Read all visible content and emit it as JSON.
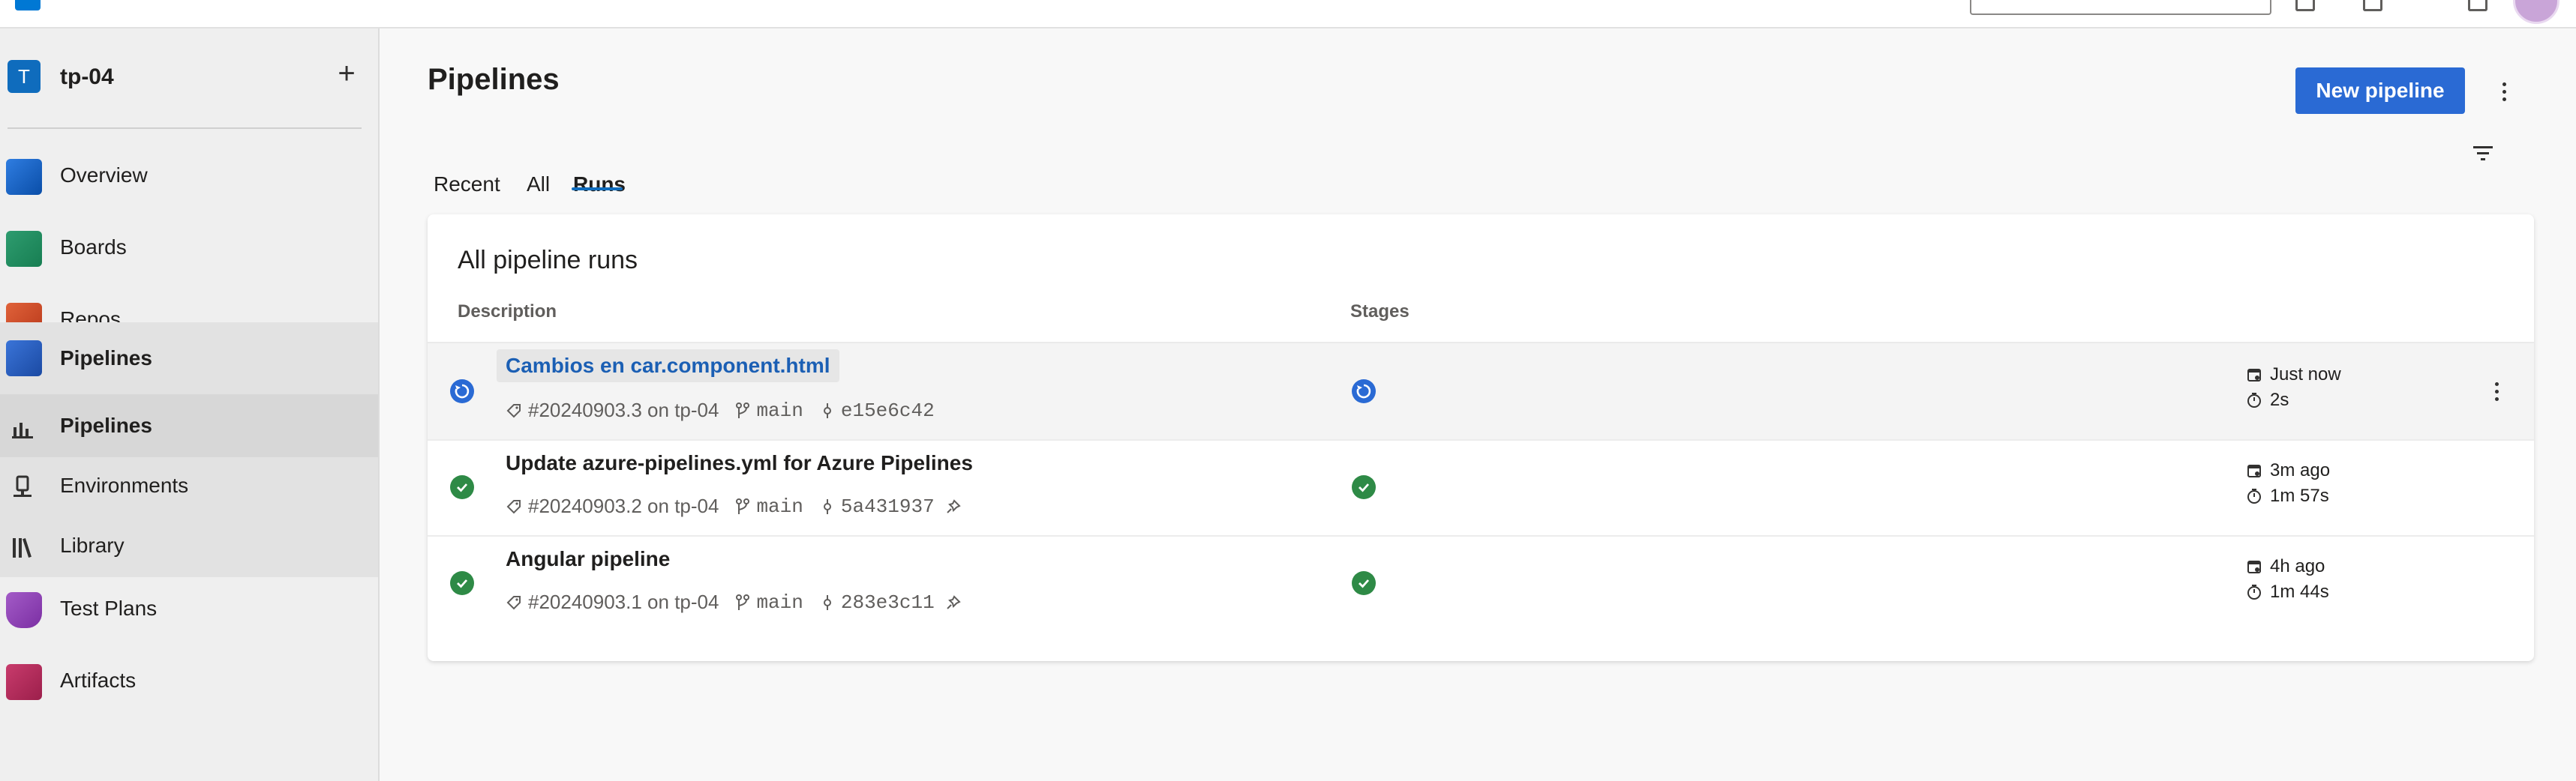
{
  "project": {
    "initial": "T",
    "name": "tp-04"
  },
  "sidebar": {
    "items": [
      {
        "label": "Overview"
      },
      {
        "label": "Boards"
      },
      {
        "label": "Repos"
      },
      {
        "label": "Pipelines"
      },
      {
        "label": "Pipelines"
      },
      {
        "label": "Environments"
      },
      {
        "label": "Library"
      },
      {
        "label": "Test Plans"
      },
      {
        "label": "Artifacts"
      }
    ]
  },
  "main": {
    "title": "Pipelines",
    "new_button": "New pipeline",
    "tabs": [
      {
        "label": "Recent"
      },
      {
        "label": "All"
      },
      {
        "label": "Runs",
        "active": true
      }
    ],
    "card_title": "All pipeline runs",
    "columns": {
      "description": "Description",
      "stages": "Stages"
    },
    "runs": [
      {
        "title": "Cambios en car.component.html",
        "run_id": "#20240903.3 on tp-04",
        "branch": "main",
        "commit": "e15e6c42",
        "status": "running",
        "stage_status": "running",
        "when": "Just now",
        "duration": "2s"
      },
      {
        "title": "Update azure-pipelines.yml for Azure Pipelines",
        "run_id": "#20240903.2 on tp-04",
        "branch": "main",
        "commit": "5a431937",
        "status": "succeeded",
        "stage_status": "succeeded",
        "when": "3m ago",
        "duration": "1m 57s"
      },
      {
        "title": "Angular pipeline",
        "run_id": "#20240903.1 on tp-04",
        "branch": "main",
        "commit": "283e3c11",
        "status": "succeeded",
        "stage_status": "succeeded",
        "when": "4h ago",
        "duration": "1m 44s"
      }
    ]
  },
  "colors": {
    "accent": "#2a6ad4",
    "success": "#2e8a46",
    "link": "#1b5fb4"
  },
  "icons": [
    "overview-icon",
    "boards-icon",
    "repos-icon",
    "pipelines-icon",
    "environments-icon",
    "library-icon",
    "test-plans-icon",
    "artifacts-icon",
    "filter-icon",
    "more-icon",
    "tag-icon",
    "branch-icon",
    "commit-icon",
    "pin-icon",
    "calendar-icon",
    "timer-icon"
  ]
}
